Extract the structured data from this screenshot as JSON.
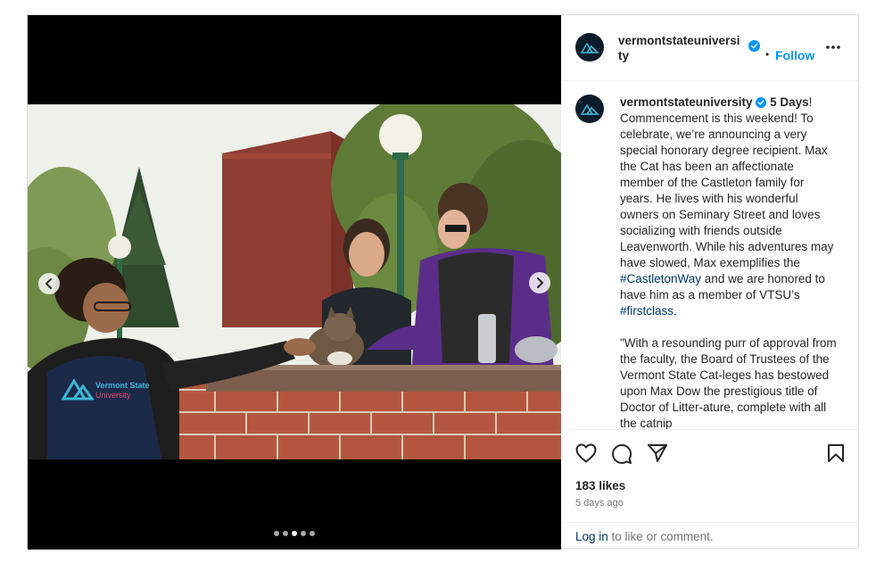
{
  "post": {
    "account": {
      "username": "vermontstateuniversity",
      "verified": true
    },
    "header": {
      "follow_label": "Follow",
      "separator": "•",
      "more_icon": "more-horizontal-icon"
    },
    "caption": {
      "lead": "5 Days",
      "paragraph1_a": "! Commencement is this weekend! To celebrate, we’re announcing a very special honorary degree recipient. Max the Cat has been an affectionate member of the Castleton family for years. He lives with his wonderful owners on Seminary Street and loves socializing with friends outside Leavenworth. While his adventures may have slowed, Max exemplifies the ",
      "hashtag1": "#CastletonWay",
      "paragraph1_b": " and we are honored to have him as a member of VTSU’s ",
      "hashtag2": "#firstclass",
      "paragraph1_c": ".",
      "paragraph2": "\"With a resounding purr of approval from the faculty, the Board of Trustees of the Vermont State Cat-leges has bestowed upon Max Dow the prestigious title of Doctor of Litter-ature, complete with all the catnip"
    },
    "shirt_text": {
      "line1": "Vermont State",
      "line2": "University"
    },
    "carousel": {
      "total": 5,
      "active_index": 2
    },
    "actions": {
      "like_icon": "heart-icon",
      "comment_icon": "comment-icon",
      "share_icon": "send-icon",
      "save_icon": "bookmark-icon"
    },
    "likes_text": "183 likes",
    "time_ago": "5 days ago",
    "comment_bar": {
      "login_label": "Log in",
      "rest": " to like or comment."
    },
    "colors": {
      "accent": "#0095f6",
      "hashtag": "#00376b",
      "avatar_bg": "#0d1b2a"
    }
  }
}
